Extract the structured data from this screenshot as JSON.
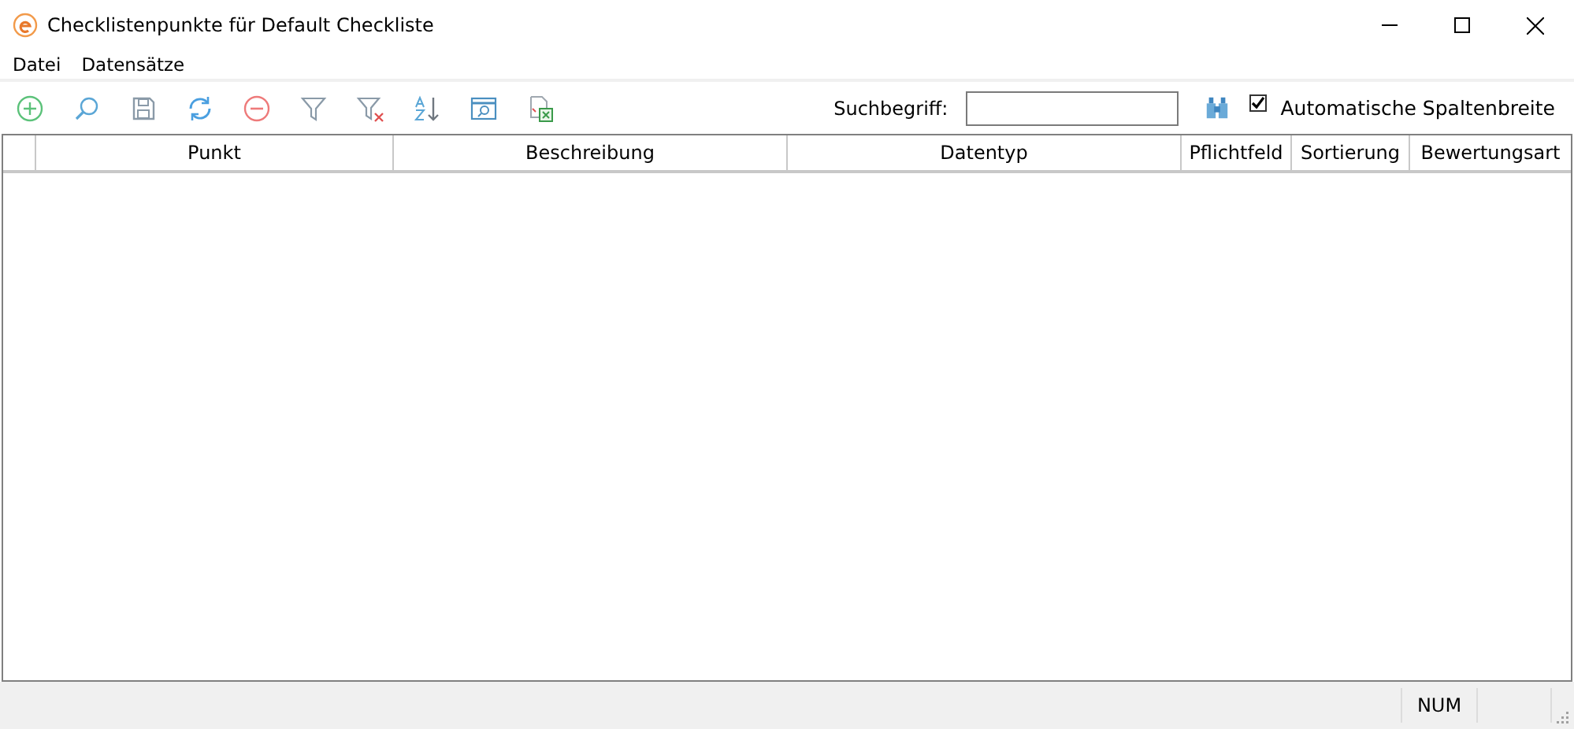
{
  "window": {
    "title": "Checklistenpunkte für Default Checkliste"
  },
  "menu": [
    "Datei",
    "Datensätze"
  ],
  "search": {
    "label": "Suchbegriff:"
  },
  "auto_width": {
    "label": "Automatische Spaltenbreite",
    "checked": true
  },
  "table": {
    "columns": [
      "Punkt",
      "Beschreibung",
      "Datentyp",
      "Pflichtfeld",
      "Sortierung",
      "Bewertungsart"
    ]
  },
  "status_bar": {
    "indicator": "NUM"
  }
}
